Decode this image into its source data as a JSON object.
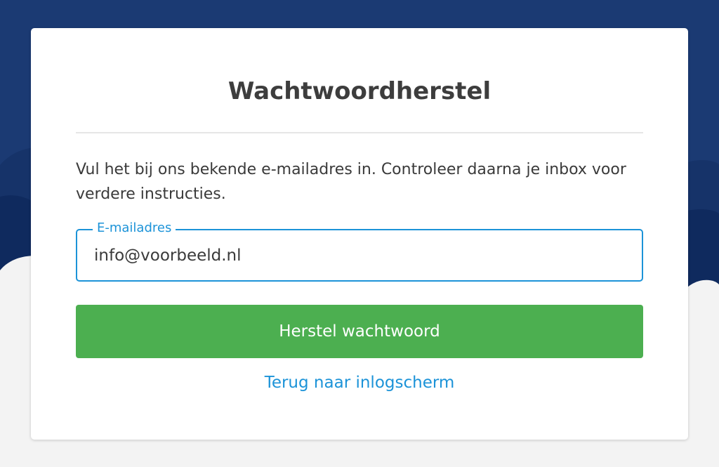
{
  "page": {
    "title": "Wachtwoordherstel",
    "instructions": "Vul het bij ons bekende e-mailadres in. Controleer daarna je inbox voor verdere instructies."
  },
  "form": {
    "email_label": "E-mailadres",
    "email_value": "info@voorbeeld.nl",
    "submit_label": "Herstel wachtwoord",
    "back_link": "Terug naar inlogscherm"
  },
  "colors": {
    "background_sky": "#1b3a73",
    "background_hills": "#0f2a5e",
    "background_ground": "#f3f3f3",
    "accent_blue": "#1c93d8",
    "button_green": "#4caf50",
    "card": "#ffffff"
  }
}
